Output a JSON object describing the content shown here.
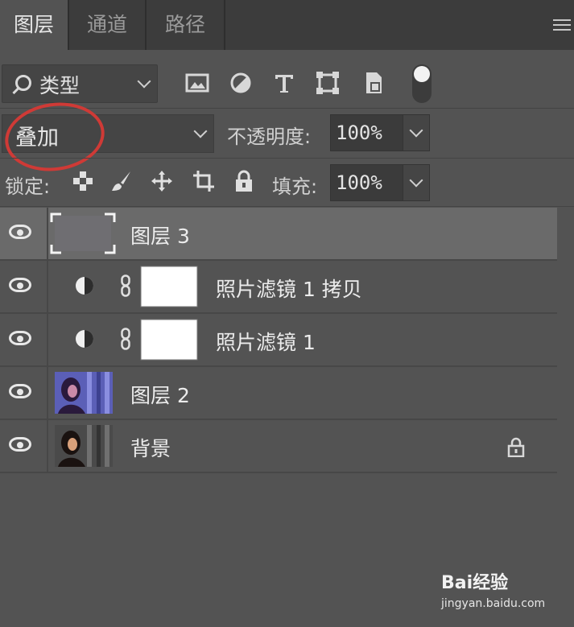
{
  "tabs": [
    {
      "label": "图层",
      "active": true
    },
    {
      "label": "通道",
      "active": false
    },
    {
      "label": "路径",
      "active": false
    }
  ],
  "filter": {
    "kind_label": "类型",
    "icons": [
      "image-filter-icon",
      "adjustment-filter-icon",
      "type-filter-icon",
      "shape-filter-icon",
      "smart-object-filter-icon"
    ],
    "toggle_on": true
  },
  "blend": {
    "mode": "叠加",
    "opacity_label": "不透明度:",
    "opacity_value": "100%"
  },
  "lock": {
    "label": "锁定:",
    "icons": [
      "lock-transparent-icon",
      "lock-image-icon",
      "lock-position-icon",
      "lock-artboard-icon",
      "lock-all-icon"
    ],
    "fill_label": "填充:",
    "fill_value": "100%"
  },
  "layers": [
    {
      "name": "图层 3",
      "type": "pixel",
      "selected": true
    },
    {
      "name": "照片滤镜 1 拷贝",
      "type": "adjustment",
      "selected": false
    },
    {
      "name": "照片滤镜 1",
      "type": "adjustment",
      "selected": false
    },
    {
      "name": "图层 2",
      "type": "photo",
      "selected": false
    },
    {
      "name": "背景",
      "type": "photo",
      "locked": true,
      "selected": false
    }
  ],
  "watermark": {
    "brand": "Bai经验",
    "url": "jingyan.baidu.com"
  },
  "colors": {
    "panel_bg": "#535353",
    "tab_bar_bg": "#3c3c3c",
    "selected_layer_bg": "#6a6a6a",
    "annotation_circle": "#cf3a36"
  }
}
